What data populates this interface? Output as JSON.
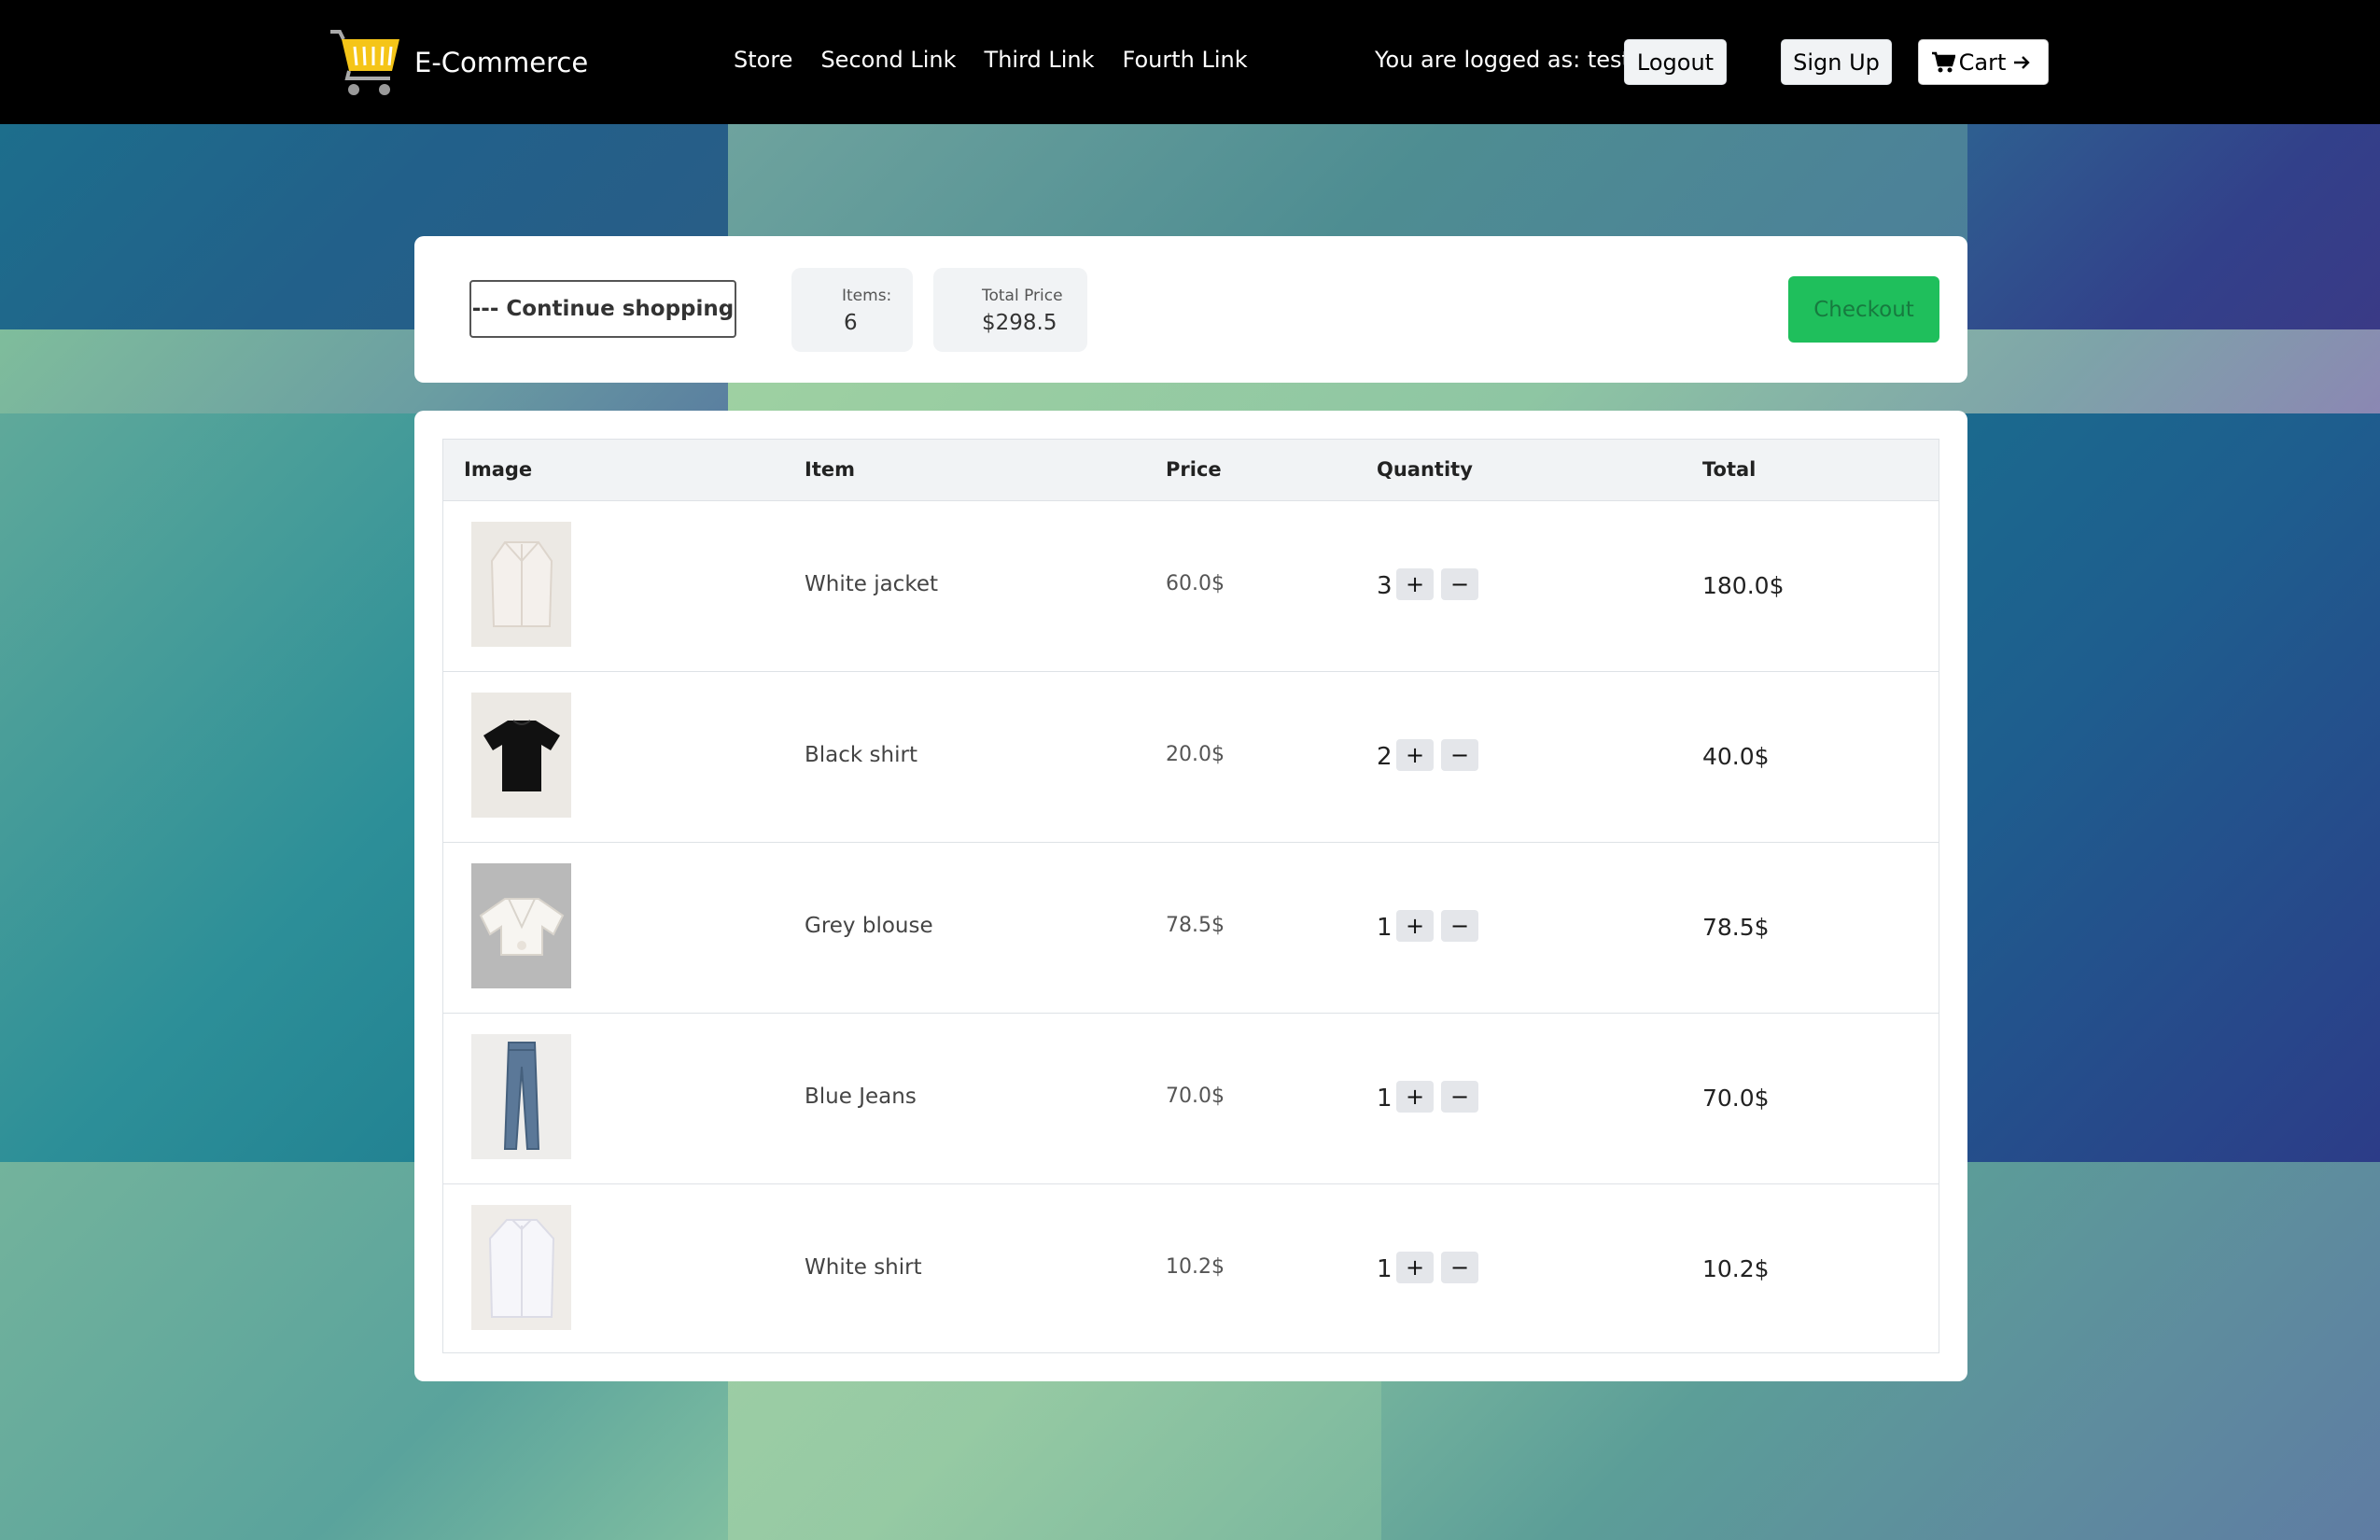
{
  "navbar": {
    "brand": "E-Commerce",
    "links": [
      "Store",
      "Second Link",
      "Third Link",
      "Fourth Link"
    ],
    "logged_text": "You are logged as: test",
    "logout_label": "Logout",
    "signup_label": "Sign Up",
    "cart_label": "Cart"
  },
  "summary": {
    "continue_label": "--- Continue shopping",
    "items_label": "Items:",
    "items_value": "6",
    "price_label": "Total Price",
    "price_value": "$298.5",
    "checkout_label": "Checkout"
  },
  "table": {
    "headers": [
      "Image",
      "Item",
      "Price",
      "Quantity",
      "Total"
    ],
    "rows": [
      {
        "image": "white-jacket-image",
        "item": "White jacket",
        "price": "60.0$",
        "quantity": "3",
        "total": "180.0$"
      },
      {
        "image": "black-shirt-image",
        "item": "Black shirt",
        "price": "20.0$",
        "quantity": "2",
        "total": "40.0$"
      },
      {
        "image": "grey-blouse-image",
        "item": "Grey blouse",
        "price": "78.5$",
        "quantity": "1",
        "total": "78.5$"
      },
      {
        "image": "blue-jeans-image",
        "item": "Blue Jeans",
        "price": "70.0$",
        "quantity": "1",
        "total": "70.0$"
      },
      {
        "image": "white-shirt-image",
        "item": "White shirt",
        "price": "10.2$",
        "quantity": "1",
        "total": "10.2$"
      }
    ],
    "plus_label": "+",
    "minus_label": "−"
  },
  "colors": {
    "navbar": "#000000",
    "checkout": "#1fbf5c",
    "logo_yellow": "#f5c518"
  }
}
